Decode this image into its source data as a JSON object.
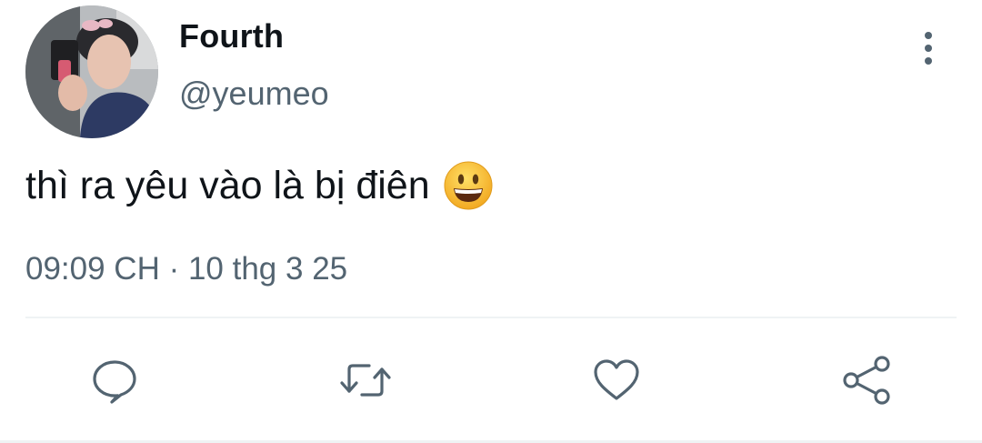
{
  "user": {
    "display_name": "Fourth",
    "handle": "@yeumeo",
    "avatar_icon": "profile-photo"
  },
  "tweet": {
    "text": "thì ra yêu vào là bị điên",
    "emoji": "grinning-face-emoji",
    "timestamp": "09:09 CH · 10 thg 3 25"
  },
  "actions": {
    "more_icon": "more-vertical-icon",
    "reply_icon": "reply-icon",
    "retweet_icon": "retweet-icon",
    "like_icon": "heart-icon",
    "share_icon": "share-icon"
  },
  "colors": {
    "text_primary": "#0f1419",
    "text_secondary": "#536471",
    "divider": "#eff3f4",
    "emoji_yellow": "#f7c02a"
  }
}
